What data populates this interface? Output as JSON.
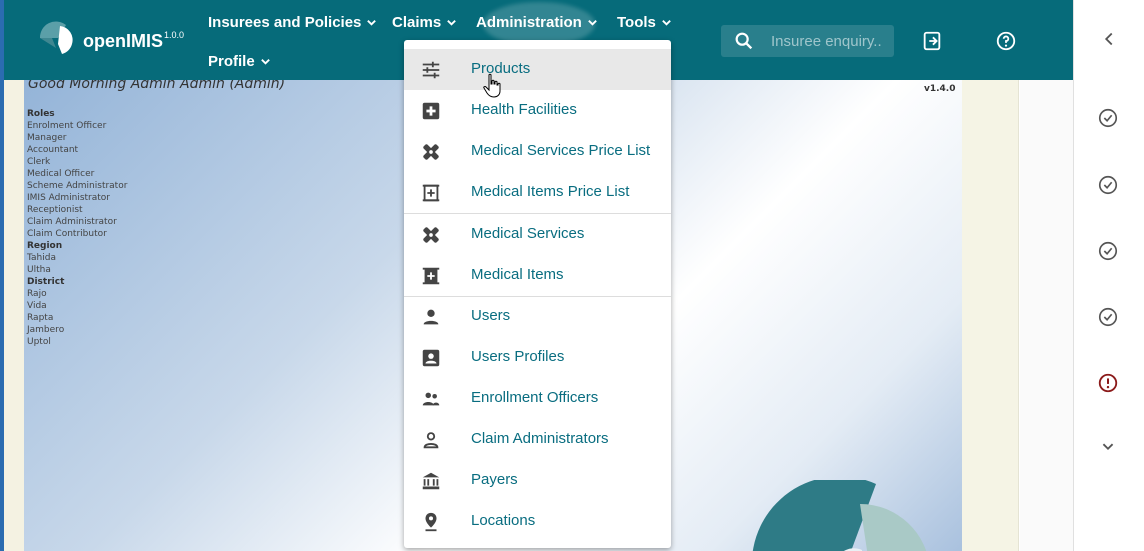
{
  "app": {
    "brand": "openIMIS",
    "version_sup": "1.0.0"
  },
  "nav": {
    "insurees_label": "Insurees and Policies",
    "claims_label": "Claims",
    "administration_label": "Administration",
    "tools_label": "Tools",
    "profile_label": "Profile"
  },
  "search": {
    "placeholder": "Insuree enquiry..."
  },
  "icons": {
    "logout": "logout-icon",
    "help": "help-icon",
    "collapse": "chevron-left-icon",
    "expand": "chevron-down-icon"
  },
  "colors": {
    "primary": "#066b7a",
    "link": "#096d80",
    "error": "#8b1a1a"
  },
  "sidebar": {
    "statuses": [
      "ok",
      "ok",
      "ok",
      "ok",
      "error"
    ]
  },
  "content": {
    "greeting": "Good Morning Admin Admin (Admin)",
    "version": "v1.4.0",
    "roles_header": "Roles",
    "roles": [
      "Enrolment Officer",
      "Manager",
      "Accountant",
      "Clerk",
      "Medical Officer",
      "Scheme Administrator",
      "IMIS Administrator",
      "Receptionist",
      "Claim Administrator",
      "Claim Contributor"
    ],
    "region_header": "Region",
    "regions": [
      "Tahida",
      "Ultha"
    ],
    "district_header": "District",
    "districts": [
      "Rajo",
      "Vida",
      "Rapta",
      "Jambero",
      "Uptol"
    ]
  },
  "admin_menu": {
    "items": [
      {
        "label": "Products",
        "icon": "sliders-icon"
      },
      {
        "label": "Health Facilities",
        "icon": "medical-cross-icon"
      },
      {
        "label": "Medical Services Price List",
        "icon": "bandages-icon"
      },
      {
        "label": "Medical Items Price List",
        "icon": "medicine-cabinet-icon"
      },
      {
        "label": "Medical Services",
        "icon": "bandages-icon"
      },
      {
        "label": "Medical Items",
        "icon": "medicine-cabinet-icon"
      },
      {
        "label": "Users",
        "icon": "person-icon"
      },
      {
        "label": "Users Profiles",
        "icon": "account-box-icon"
      },
      {
        "label": "Enrollment Officers",
        "icon": "people-icon"
      },
      {
        "label": "Claim Administrators",
        "icon": "person-outline-icon"
      },
      {
        "label": "Payers",
        "icon": "bank-icon"
      },
      {
        "label": "Locations",
        "icon": "location-pin-icon"
      }
    ]
  }
}
